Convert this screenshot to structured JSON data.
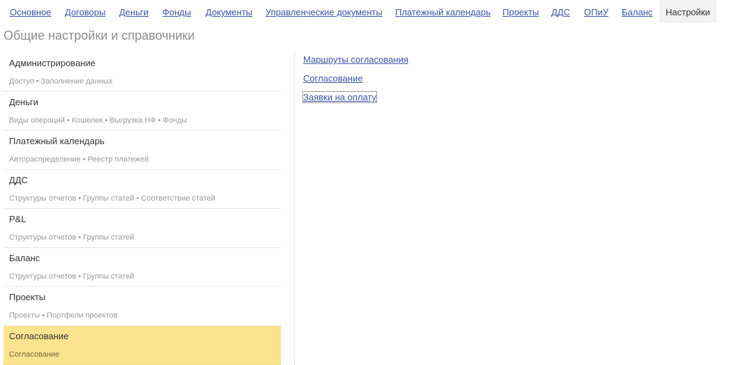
{
  "nav": {
    "tabs": [
      {
        "label": "Основное"
      },
      {
        "label": "Договоры"
      },
      {
        "label": "Деньги"
      },
      {
        "label": "Фонды"
      },
      {
        "label": "Документы"
      },
      {
        "label": "Управленческие документы"
      },
      {
        "label": "Платежный календарь"
      },
      {
        "label": "Проекты"
      },
      {
        "label": "ДДС"
      },
      {
        "label": "ОПиУ"
      },
      {
        "label": "Баланс"
      },
      {
        "label": "Настройки",
        "active": true
      }
    ]
  },
  "page": {
    "title": "Общие настройки и справочники"
  },
  "sections": [
    {
      "title": "Администрирование",
      "sub": "Доступ • Заполнение данных"
    },
    {
      "title": "Деньги",
      "sub": "Виды операций • Кошелек • Выгрузка НФ • Фонды"
    },
    {
      "title": "Платежный календарь",
      "sub": "Автораспределение • Реестр платежей"
    },
    {
      "title": "ДДС",
      "sub": "Структуры отчетов • Группы статей • Соответствие статей"
    },
    {
      "title": "P&L",
      "sub": "Структуры отчетов • Группы статей"
    },
    {
      "title": "Баланс",
      "sub": "Структуры отчетов • Группы статей"
    },
    {
      "title": "Проекты",
      "sub": "Проекты • Портфели проектов"
    },
    {
      "title": "Согласование",
      "sub": "Согласование",
      "selected": true
    }
  ],
  "links": [
    {
      "label": "Маршруты согласования"
    },
    {
      "label": "Согласование"
    },
    {
      "label": "Заявки на оплату",
      "focused": true
    }
  ],
  "colors": {
    "link": "#3a54a4",
    "selected_bg": "#fbe38f",
    "active_tab_bg": "#f2f2f2"
  }
}
